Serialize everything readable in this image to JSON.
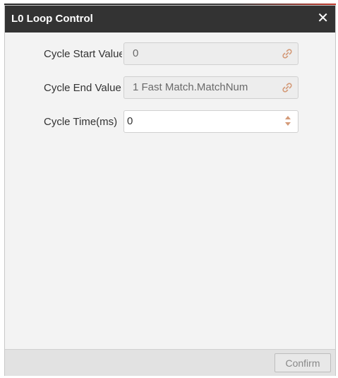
{
  "dialog": {
    "title": "L0 Loop Control",
    "close_glyph": "✕"
  },
  "fields": [
    {
      "label": "Cycle Start Value",
      "value": "0",
      "icon": "link-icon"
    },
    {
      "label": "Cycle End Value",
      "value": "1 Fast Match.MatchNum",
      "icon": "link-icon"
    },
    {
      "label": "Cycle Time(ms)",
      "value": "0",
      "icon": "spinner-arrows"
    }
  ],
  "footer": {
    "confirm_label": "Confirm"
  },
  "colors": {
    "titlebar": "#333333",
    "body": "#f3f3f3",
    "accent": "#d49a78"
  }
}
